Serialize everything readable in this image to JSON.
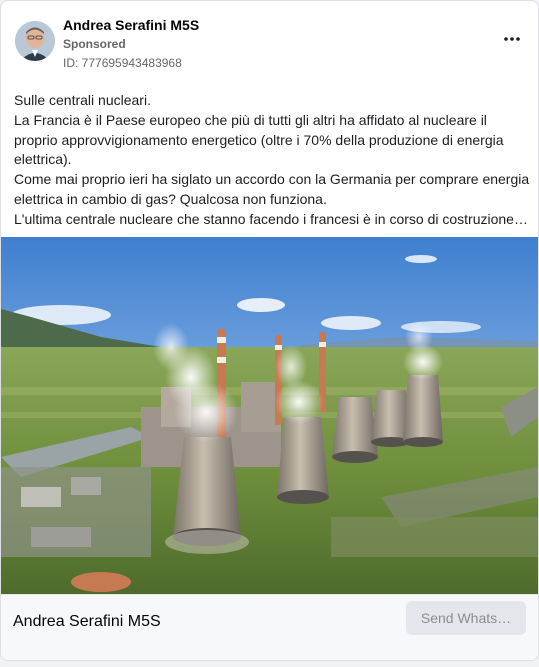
{
  "post": {
    "author": "Andrea Serafini M5S",
    "sponsored_label": "Sponsored",
    "ad_id": "ID: 777695943483968",
    "text_lines": [
      "Sulle centrali nucleari.",
      "La Francia è il Paese europeo che più di tutti gli altri ha affidato al nucleare il",
      "proprio approvvigionamento energetico (oltre i 70% della produzione di energia",
      "elettrica).",
      "Come mai proprio ieri ha siglato un accordo con la Germania per comprare energia",
      "elettrica in cambio di gas? Qualcosa non funziona.",
      "L'ultima centrale nucleare che stanno facendo i francesi è in corso di costruzione…"
    ]
  },
  "footer": {
    "page_name": "Andrea Serafini M5S",
    "cta_label": "Send Whats…"
  },
  "icons": {
    "more": "more-options-icon",
    "avatar": "profile-photo"
  },
  "colors": {
    "secondary_text": "#65676b",
    "cta_bg": "#e4e6eb",
    "cta_text": "#8a8d91"
  }
}
